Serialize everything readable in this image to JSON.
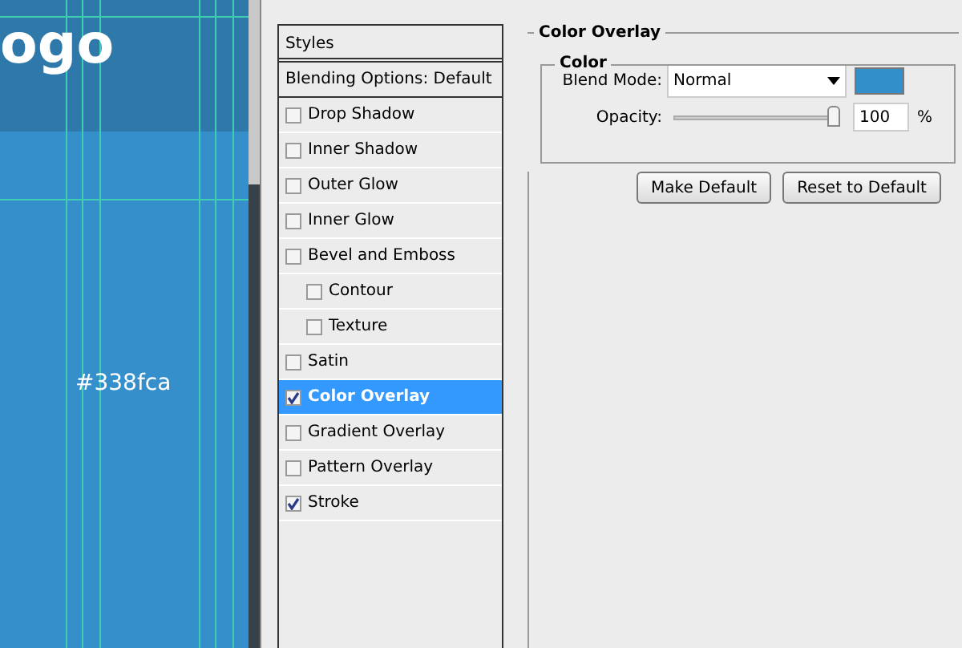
{
  "canvas": {
    "logo": "ogo",
    "color_label": "#338fca"
  },
  "styles_panel": {
    "header": "Styles",
    "blending_options": "Blending Options: Default",
    "items": [
      {
        "label": "Drop Shadow",
        "checked": false,
        "selected": false
      },
      {
        "label": "Inner Shadow",
        "checked": false,
        "selected": false
      },
      {
        "label": "Outer Glow",
        "checked": false,
        "selected": false
      },
      {
        "label": "Inner Glow",
        "checked": false,
        "selected": false
      },
      {
        "label": "Bevel and Emboss",
        "checked": false,
        "selected": false,
        "children": [
          {
            "label": "Contour",
            "checked": false,
            "selected": false
          },
          {
            "label": "Texture",
            "checked": false,
            "selected": false
          }
        ]
      },
      {
        "label": "Satin",
        "checked": false,
        "selected": false
      },
      {
        "label": "Color Overlay",
        "checked": true,
        "selected": true
      },
      {
        "label": "Gradient Overlay",
        "checked": false,
        "selected": false
      },
      {
        "label": "Pattern Overlay",
        "checked": false,
        "selected": false
      },
      {
        "label": "Stroke",
        "checked": true,
        "selected": false
      }
    ]
  },
  "color_overlay": {
    "title": "Color Overlay",
    "group_title": "Color",
    "blend_mode": {
      "label": "Blend Mode:",
      "value": "Normal",
      "color": "#338fca"
    },
    "opacity": {
      "label": "Opacity:",
      "level": 1,
      "value": "100",
      "unit": "%"
    },
    "buttons": [
      "Make Default",
      "Reset to Default"
    ]
  }
}
